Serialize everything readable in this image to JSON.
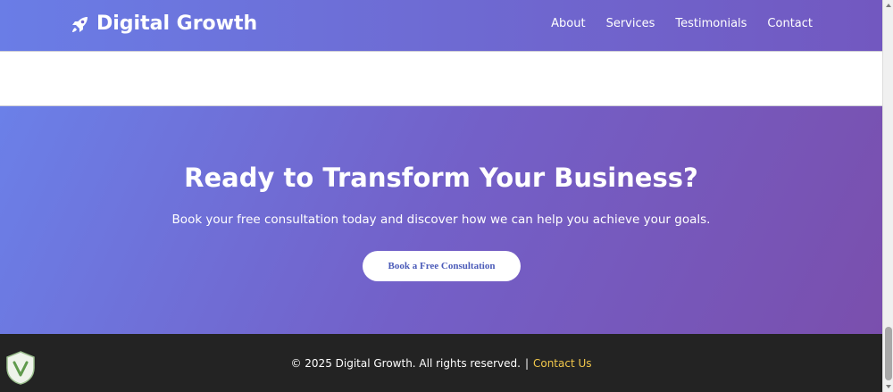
{
  "navbar": {
    "brand": "Digital Growth",
    "brand_icon": "rocket-icon",
    "links": [
      "About",
      "Services",
      "Testimonials",
      "Contact"
    ]
  },
  "cta": {
    "heading": "Ready to Transform Your Business?",
    "subtext": "Book your free consultation today and discover how we can help you achieve your goals.",
    "button_label": "Book a Free Consultation"
  },
  "footer": {
    "copyright": "© 2025 Digital Growth. All rights reserved.",
    "separator": "|",
    "contact_link": "Contact Us"
  },
  "colors": {
    "gradient_start": "#6b80e8",
    "gradient_end": "#7a4fad",
    "footer_bg": "#232323",
    "link_accent": "#f2c84b"
  }
}
